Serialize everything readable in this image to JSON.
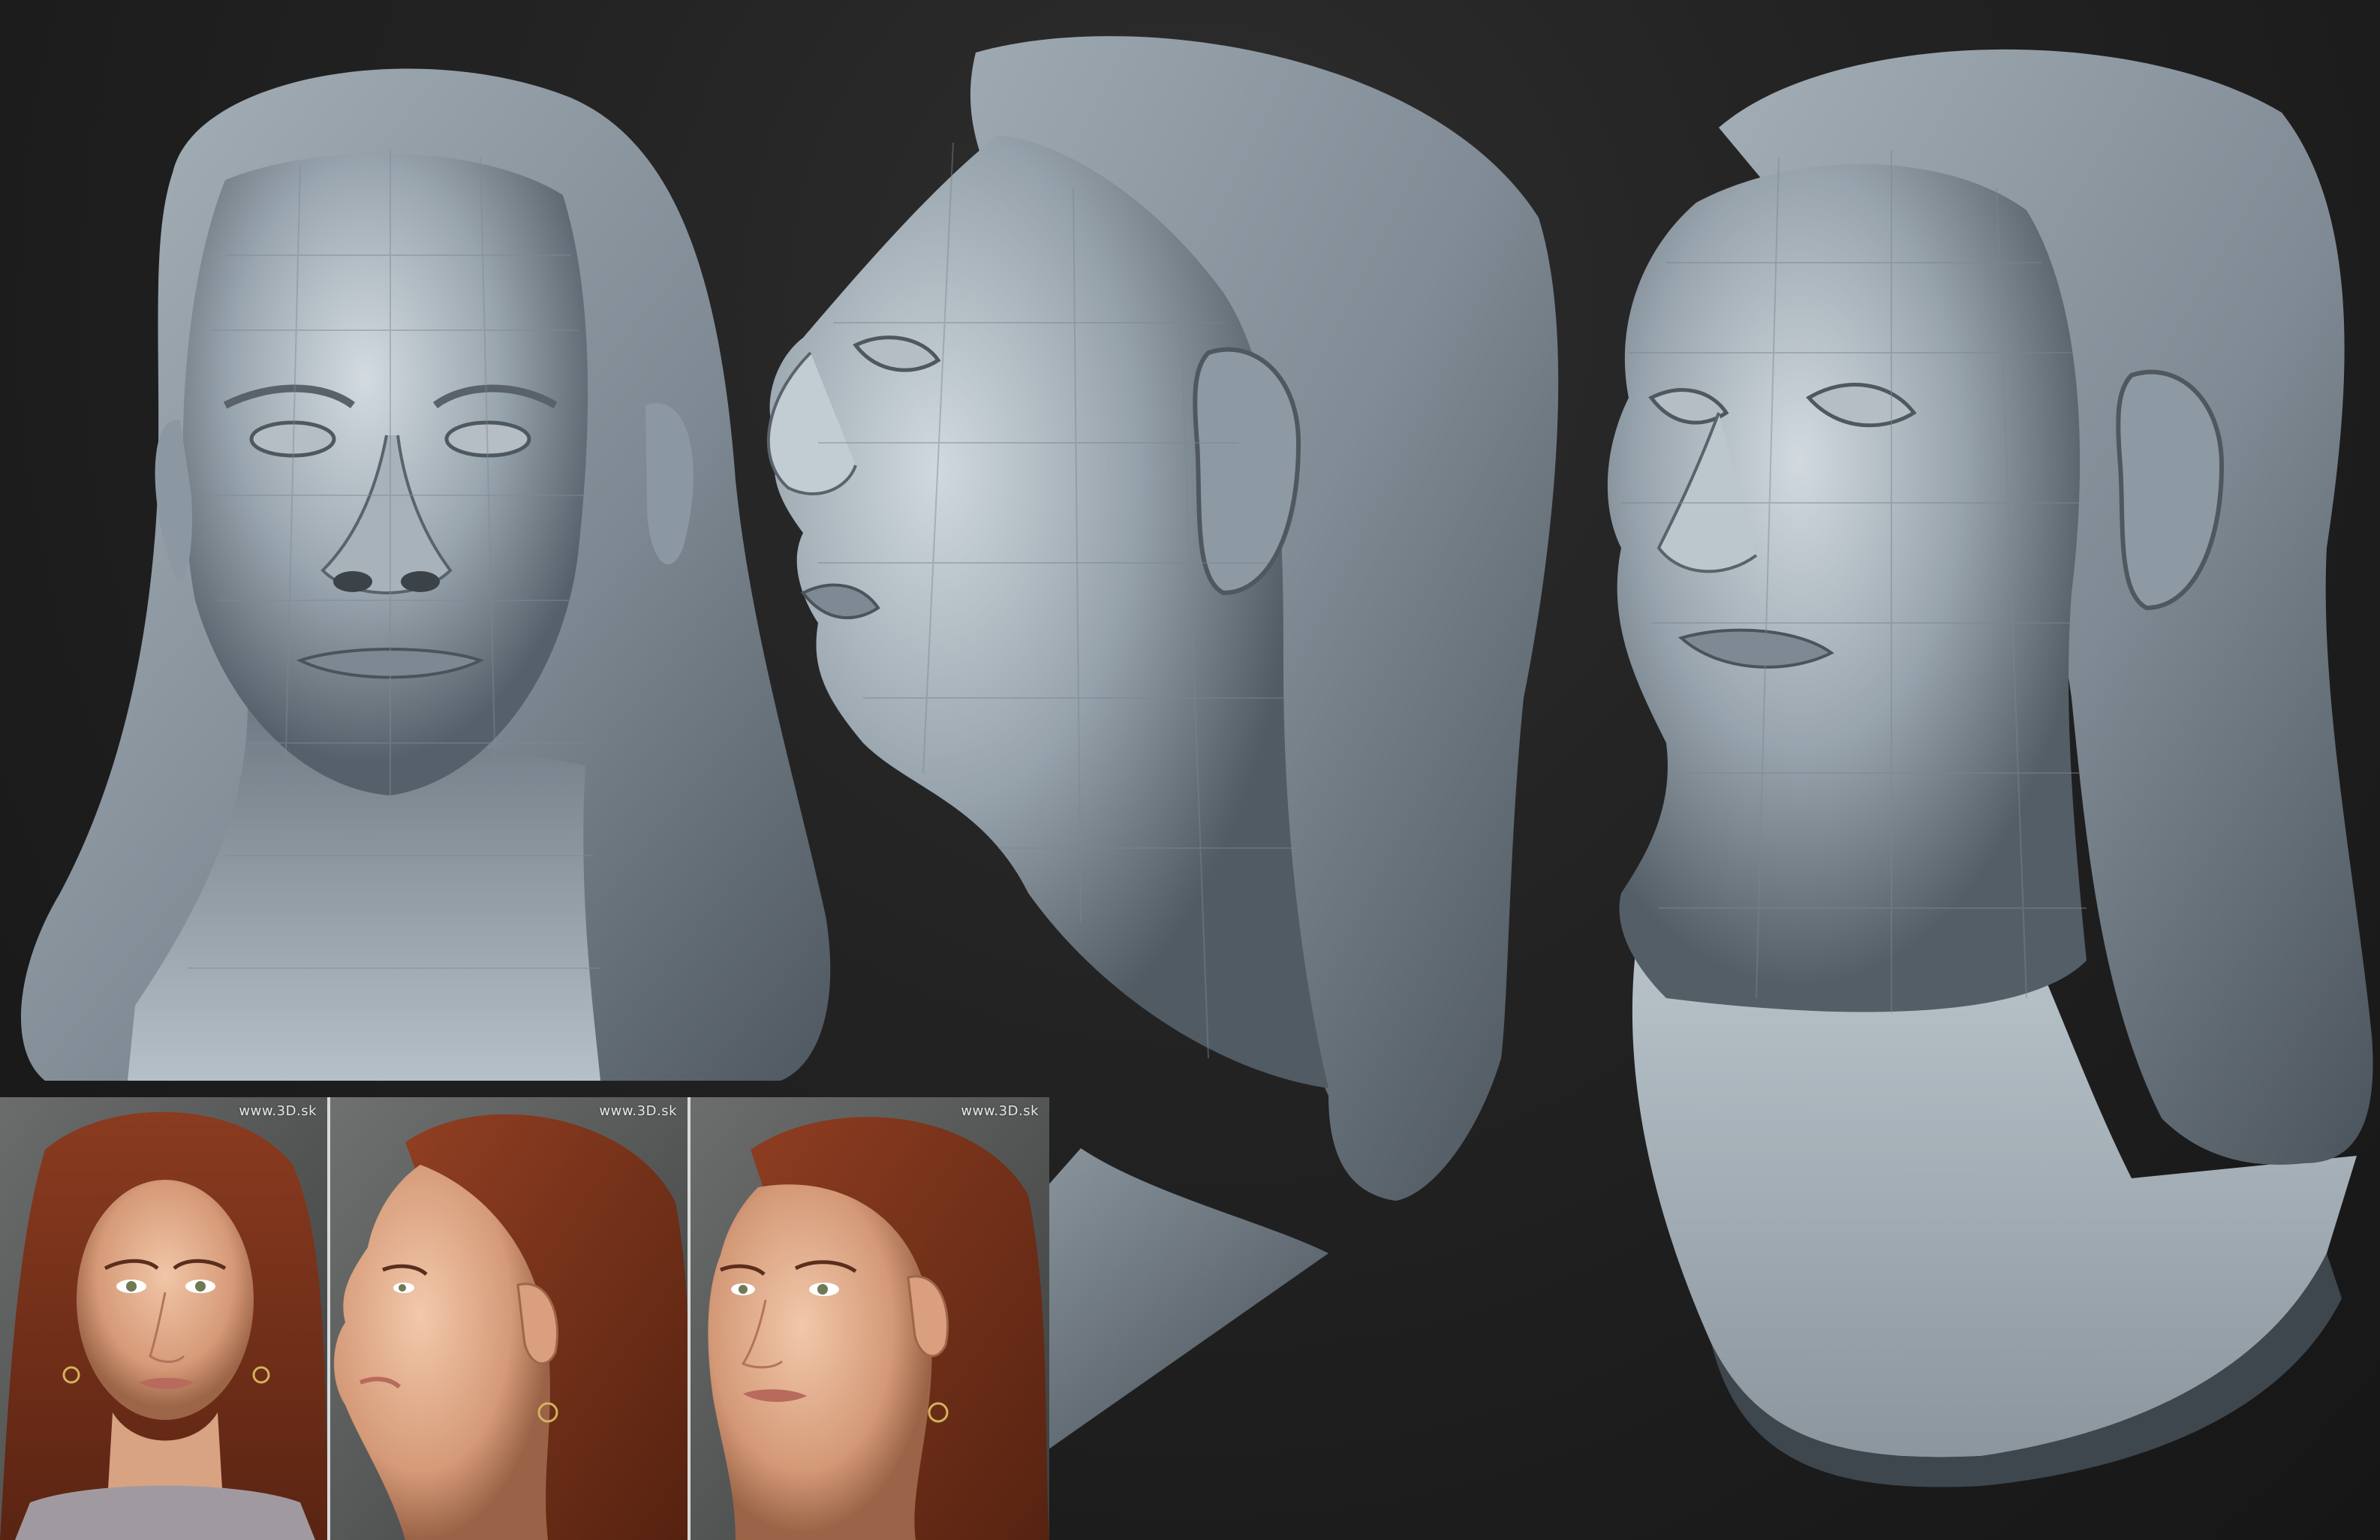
{
  "scene": {
    "background_color": "#1b1b1b",
    "sculpt_color": "#8f9ba5",
    "sculpt_highlight": "#c9d2d9",
    "sculpt_shadow": "#4d565d"
  },
  "sculpt_views": [
    {
      "name": "front-view"
    },
    {
      "name": "side-view"
    },
    {
      "name": "three-quarter-view"
    }
  ],
  "reference_photos": [
    {
      "name": "front-photo",
      "watermark": "www.3D.sk"
    },
    {
      "name": "side-photo",
      "watermark": "www.3D.sk"
    },
    {
      "name": "three-quarter-photo",
      "watermark": "www.3D.sk"
    }
  ]
}
